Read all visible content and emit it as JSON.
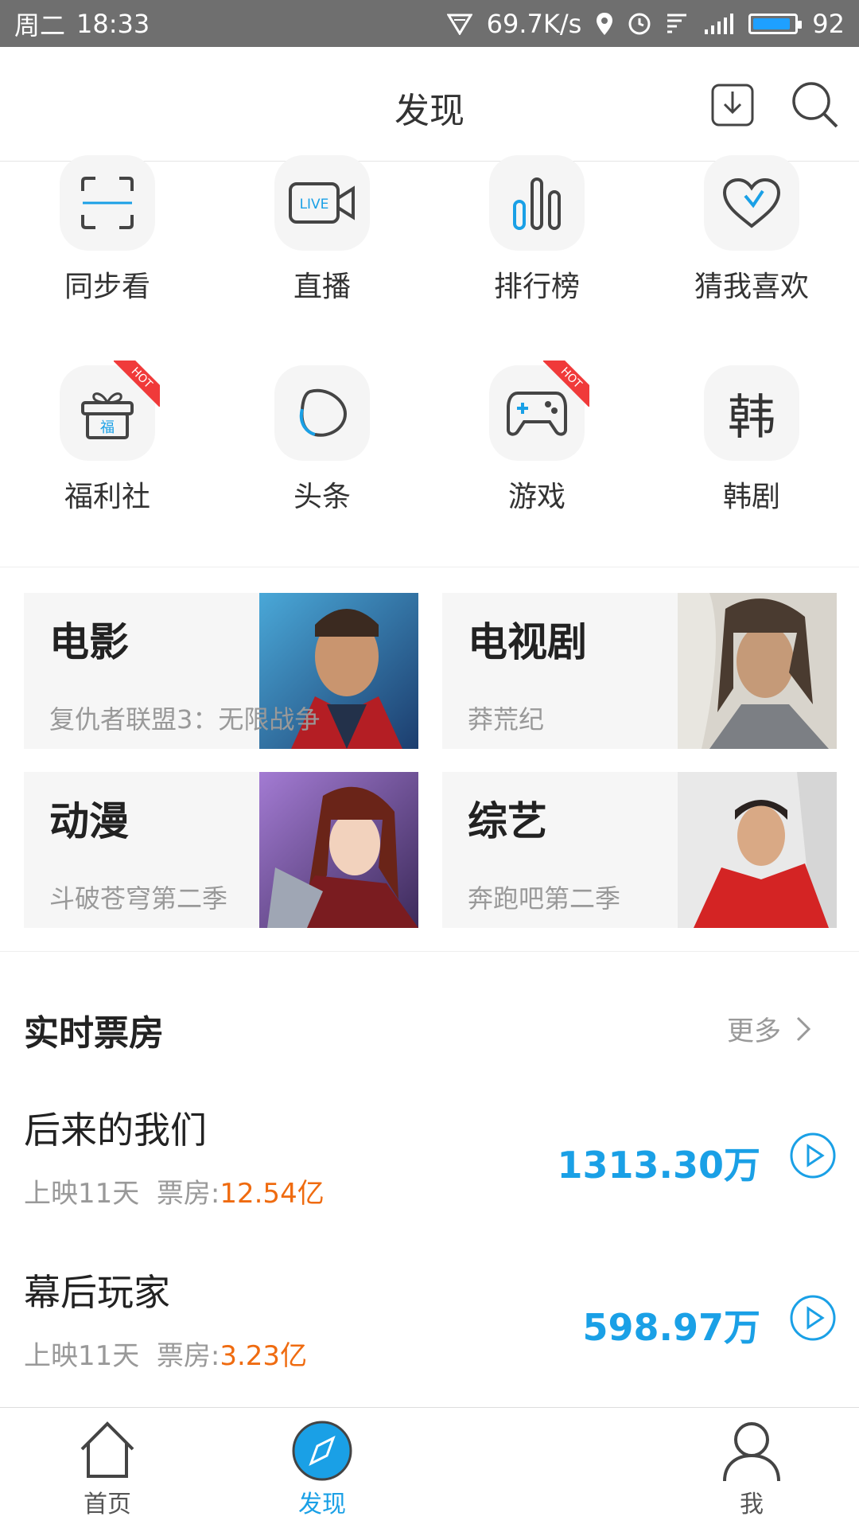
{
  "status_bar": {
    "day": "周二",
    "time": "18:33",
    "net_speed": "69.7K/s",
    "battery": "92",
    "battery_level_percent": 92,
    "accent": "#1ea0ff"
  },
  "header": {
    "title": "发现",
    "download_icon": "download-icon",
    "search_icon": "search-icon"
  },
  "quick_links": [
    {
      "label": "同步看",
      "icon": "scan-frame-icon",
      "hot": false
    },
    {
      "label": "直播",
      "icon": "live-camera-icon",
      "hot": false
    },
    {
      "label": "排行榜",
      "icon": "bar-chart-icon",
      "hot": false
    },
    {
      "label": "猜我喜欢",
      "icon": "heart-icon",
      "hot": false
    },
    {
      "label": "福利社",
      "icon": "gift-icon",
      "hot": true
    },
    {
      "label": "头条",
      "icon": "headline-blob-icon",
      "hot": false
    },
    {
      "label": "游戏",
      "icon": "gamepad-icon",
      "hot": true
    },
    {
      "label": "韩剧",
      "icon": "korean-char-icon",
      "hot": false
    }
  ],
  "hot_badge": "HOT",
  "korean_glyph": "韩",
  "live_text": "LIVE",
  "gift_char": "福",
  "categories": [
    {
      "title": "电影",
      "subtitle": "复仇者联盟3：无限战争"
    },
    {
      "title": "电视剧",
      "subtitle": "莽荒纪"
    },
    {
      "title": "动漫",
      "subtitle": "斗破苍穹第二季"
    },
    {
      "title": "综艺",
      "subtitle": "奔跑吧第二季"
    }
  ],
  "box_office": {
    "title": "实时票房",
    "more": "更多",
    "items": [
      {
        "name": "后来的我们",
        "days": "上映11天",
        "total_label": "票房:",
        "total": "12.54亿",
        "realtime": "1313.30万"
      },
      {
        "name": "幕后玩家",
        "days": "上映11天",
        "total_label": "票房:",
        "total": "3.23亿",
        "realtime": "598.97万"
      }
    ]
  },
  "tabs": [
    {
      "label": "首页",
      "icon": "home-icon",
      "active": false
    },
    {
      "label": "发现",
      "icon": "compass-icon",
      "active": true
    },
    {
      "label": "我",
      "icon": "profile-icon",
      "active": false
    }
  ],
  "colors": {
    "brand_blue": "#1aa0e6",
    "orange": "#ef6b10",
    "hot_red": "#f03a3a"
  }
}
